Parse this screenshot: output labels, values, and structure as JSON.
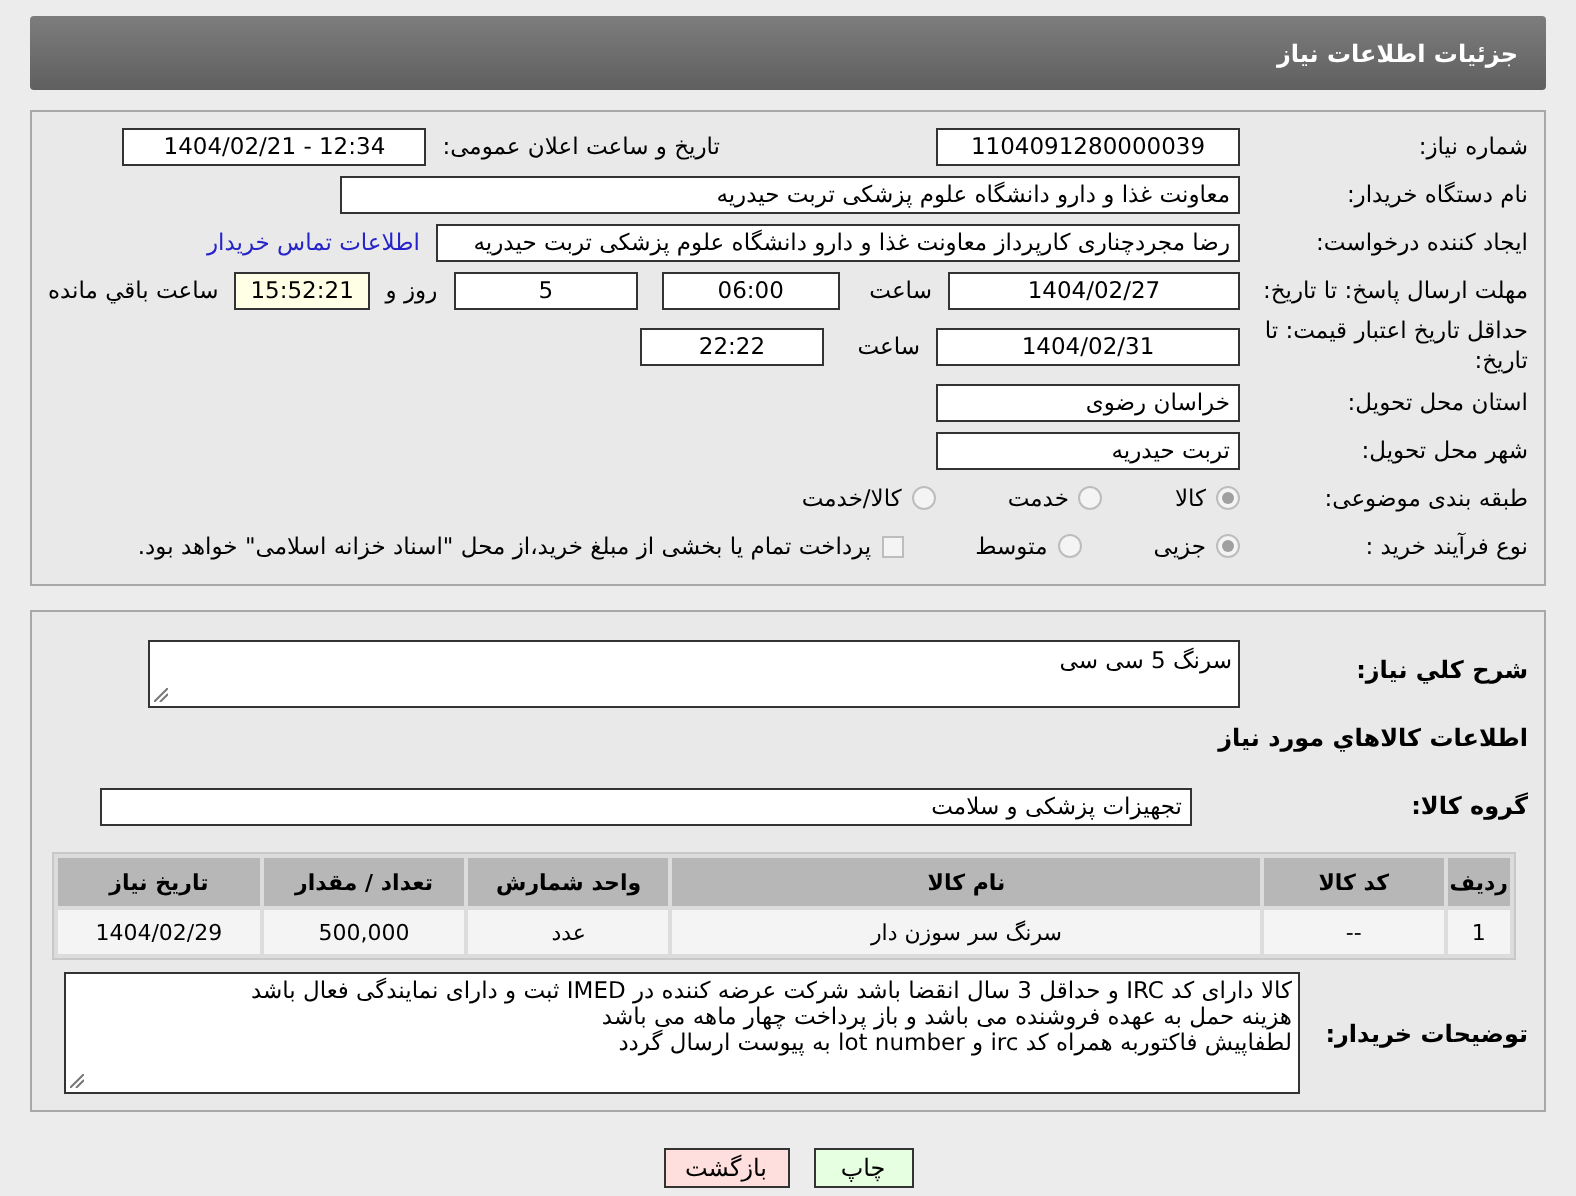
{
  "header": {
    "title": "جزئیات اطلاعات نیاز"
  },
  "need_number": {
    "label": "شماره نیاز:",
    "value": "1104091280000039"
  },
  "announce": {
    "label": "تاریخ و ساعت اعلان عمومی:",
    "value": "1404/02/21 - 12:34"
  },
  "buyer_org": {
    "label": "نام دستگاه خریدار:",
    "value": "معاونت غذا و دارو   دانشگاه علوم پزشکی تربت حیدریه"
  },
  "requester": {
    "label": "ایجاد کننده درخواست:",
    "value": "رضا مجردچناری کارپرداز معاونت غذا و دارو   دانشگاه علوم پزشکی تربت حیدریه",
    "link": "اطلاعات تماس خریدار"
  },
  "reply_deadline": {
    "label": "مهلت ارسال پاسخ: تا تاریخ:",
    "date": "1404/02/27",
    "time_label": "ساعت",
    "time": "06:00",
    "days": "5",
    "days_label": "روز و",
    "remaining": "15:52:21",
    "remaining_label": "ساعت باقي مانده"
  },
  "price_validity": {
    "label": "حداقل تاریخ اعتبار قیمت: تا تاریخ:",
    "date": "1404/02/31",
    "time_label": "ساعت",
    "time": "22:22"
  },
  "province": {
    "label": "استان محل تحویل:",
    "value": "خراسان رضوی"
  },
  "city": {
    "label": "شهر محل تحویل:",
    "value": "تربت حیدریه"
  },
  "category": {
    "label": "طبقه بندی موضوعی:",
    "options": [
      {
        "label": "کالا",
        "selected": true
      },
      {
        "label": "خدمت",
        "selected": false
      },
      {
        "label": "کالا/خدمت",
        "selected": false
      }
    ]
  },
  "process": {
    "label": "نوع فرآیند خرید :",
    "options": [
      {
        "label": "جزیی",
        "selected": true
      },
      {
        "label": "متوسط",
        "selected": false
      }
    ],
    "treasury": {
      "label": "پرداخت تمام یا بخشی از مبلغ خرید،از محل \"اسناد خزانه اسلامی\" خواهد بود.",
      "checked": false
    }
  },
  "summary": {
    "label": "شرح کلي نیاز:",
    "value": "سرنگ 5 سی سی"
  },
  "goods_heading": "اطلاعات کالاهاي مورد نیاز",
  "goods_group": {
    "label": "گروه کالا:",
    "value": "تجهیزات پزشکی و سلامت"
  },
  "table": {
    "columns": [
      "ردیف",
      "کد کالا",
      "نام کالا",
      "واحد شمارش",
      "تعداد / مقدار",
      "تاریخ نیاز"
    ],
    "rows": [
      [
        "1",
        "--",
        "سرنگ سر سوزن دار",
        "عدد",
        "500,000",
        "1404/02/29"
      ]
    ]
  },
  "buyer_notes": {
    "label": "توضیحات خریدار:",
    "lines": [
      "کالا دارای کد IRC و حداقل 3 سال انقضا باشد شرکت عرضه کننده در IMED ثبت و دارای نمایندگی فعال باشد",
      "هزینه حمل به عهده فروشنده می باشد و باز پرداخت چهار ماهه می باشد",
      "لطفاپیش فاکتوربه همراه کد irc و lot number به پیوست ارسال گردد"
    ]
  },
  "buttons": [
    {
      "label": "چاپ",
      "kind": "print"
    },
    {
      "label": "بازگشت",
      "kind": "back"
    }
  ]
}
